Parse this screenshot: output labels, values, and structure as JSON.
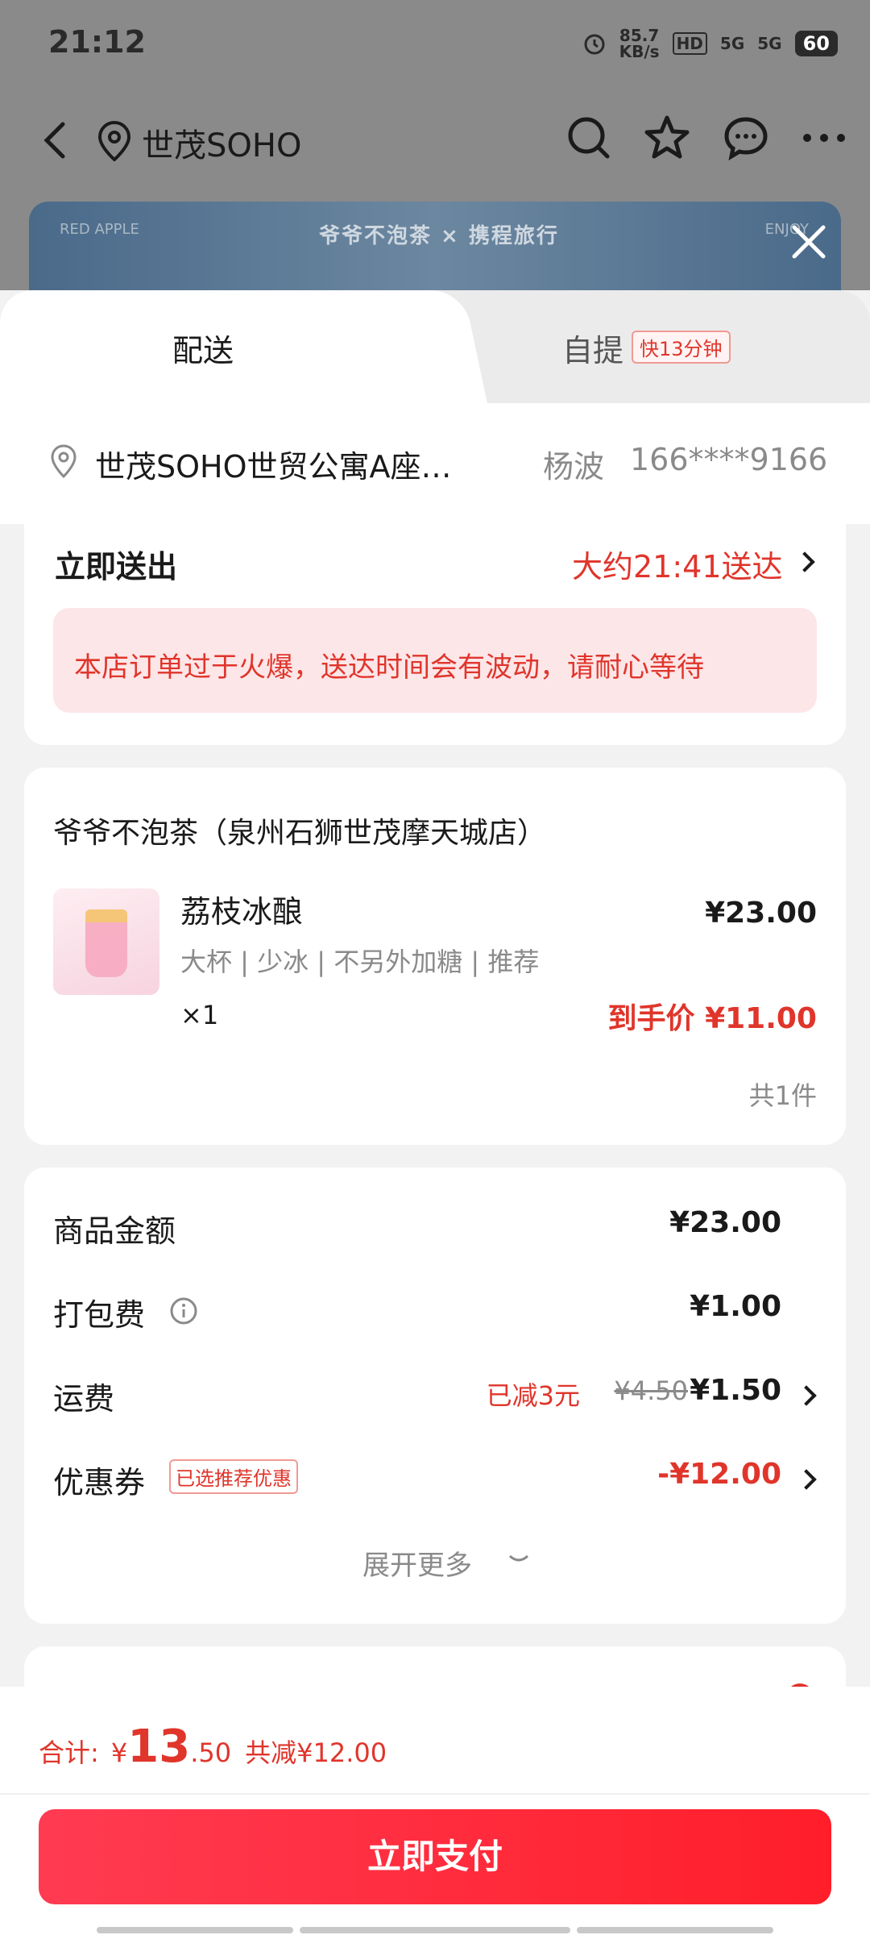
{
  "status_bar": {
    "time": "21:12",
    "speed_value": "85.7",
    "speed_unit": "KB/s",
    "signal_1": "5G",
    "signal_2": "5G",
    "battery": "60"
  },
  "header": {
    "title": "世茂SOHO"
  },
  "banner": {
    "brand_text": "爷爷不泡茶 × 携程旅行",
    "left_text": "RED APPLE",
    "right_text": "ENJOY"
  },
  "tabs": [
    {
      "label": "配送"
    },
    {
      "label": "自提",
      "badge": "快13分钟"
    }
  ],
  "address": {
    "text": "世茂SOHO世贸公寓A座…",
    "name": "杨波",
    "phone": "166****9166"
  },
  "delivery": {
    "label": "立即送出",
    "eta": "大约21:41送达",
    "notice": "本店订单过于火爆，送达时间会有波动，请耐心等待"
  },
  "order": {
    "shop_name": "爷爷不泡茶（泉州石狮世茂摩天城店）",
    "item": {
      "name": "荔枝冰酿",
      "specs": "大杯 | 少冰 | 不另外加糖 | 推荐",
      "quantity": "×1",
      "price": "¥23.00",
      "final_price": "到手价 ¥11.00"
    },
    "total_count": "共1件"
  },
  "fees": {
    "goods_label": "商品金额",
    "goods_value": "¥23.00",
    "packing_label": "打包费",
    "packing_value": "¥1.00",
    "shipping_label": "运费",
    "shipping_discount": "已减3元",
    "shipping_original": "¥4.50",
    "shipping_value": "¥1.50",
    "coupon_label": "优惠券",
    "coupon_tag": "已选推荐优惠",
    "coupon_value": "-¥12.00",
    "expand_label": "展开更多"
  },
  "footer": {
    "total_label": "合计:",
    "currency": "¥",
    "total_integer": "13",
    "total_decimal": ".50",
    "discount_text": "共减¥12.00",
    "pay_button": "立即支付"
  },
  "colors": {
    "accent_red": "#e0352b",
    "pay_button": "#ff2a3a"
  }
}
